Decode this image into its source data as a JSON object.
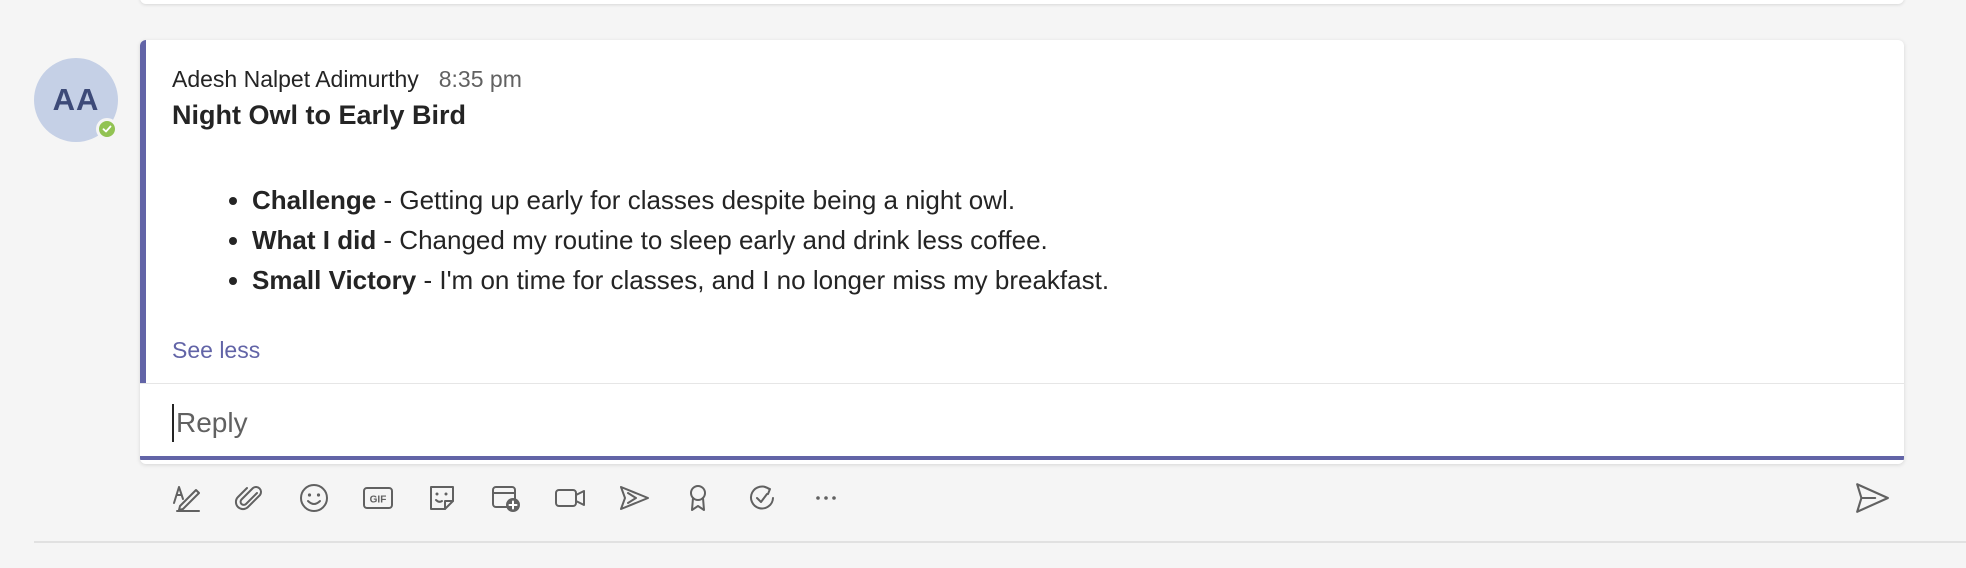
{
  "message": {
    "avatar_initials": "AA",
    "author": "Adesh Nalpet Adimurthy",
    "time": "8:35 pm",
    "subject": "Night Owl to Early Bird",
    "bullets": [
      {
        "label": "Challenge",
        "text": " - Getting up early for classes despite being a night owl."
      },
      {
        "label": "What I did",
        "text": " - Changed my routine to sleep early and drink less coffee."
      },
      {
        "label": "Small Victory",
        "text": " - I'm on time for classes, and I no longer miss my breakfast."
      }
    ],
    "see_less": "See less"
  },
  "reply": {
    "placeholder": "Reply"
  },
  "toolbar": {
    "gif_label": "GIF",
    "icons": [
      "format-icon",
      "attach-icon",
      "emoji-icon",
      "gif-icon",
      "sticker-icon",
      "schedule-meeting-icon",
      "video-icon",
      "stream-icon",
      "praise-icon",
      "loop-icon",
      "more-options-icon",
      "send-icon"
    ]
  },
  "colors": {
    "accent": "#6264a7",
    "presence": "#92c353",
    "avatar_bg": "#c5d0e6"
  }
}
